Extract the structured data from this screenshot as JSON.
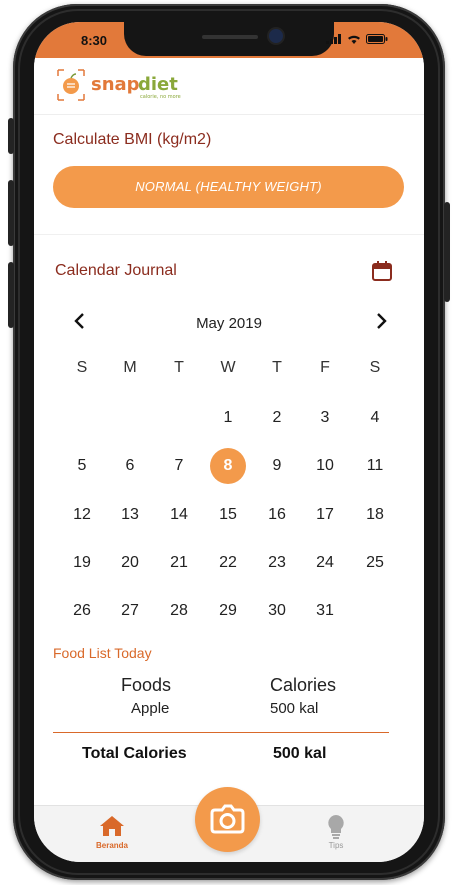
{
  "status_bar": {
    "time": "8:30"
  },
  "app": {
    "logo_text": "snapdiet",
    "tagline": "calorie, no more"
  },
  "bmi": {
    "title": "Calculate BMI (kg/m2)",
    "result": "NORMAL (HEALTHY WEIGHT)"
  },
  "calendar": {
    "title": "Calendar Journal",
    "month_label": "May 2019",
    "weekdays": [
      "S",
      "M",
      "T",
      "W",
      "T",
      "F",
      "S"
    ],
    "weeks": [
      [
        "",
        "",
        "",
        "1",
        "2",
        "3",
        "4"
      ],
      [
        "5",
        "6",
        "7",
        "8",
        "9",
        "10",
        "11"
      ],
      [
        "12",
        "13",
        "14",
        "15",
        "16",
        "17",
        "18"
      ],
      [
        "19",
        "20",
        "21",
        "22",
        "23",
        "24",
        "25"
      ],
      [
        "26",
        "27",
        "28",
        "29",
        "30",
        "31",
        ""
      ]
    ],
    "selected_day": "8"
  },
  "food_list": {
    "title": "Food List Today",
    "headers": {
      "foods": "Foods",
      "calories": "Calories"
    },
    "rows": [
      {
        "food": "Apple",
        "calories": "500 kal"
      }
    ],
    "total_label": "Total Calories",
    "total_value": "500 kal"
  },
  "bottom_nav": {
    "items": [
      {
        "label": "Beranda",
        "icon": "home-icon"
      },
      {
        "label": "Tips",
        "icon": "lightbulb-icon"
      }
    ],
    "fab_icon": "camera-icon"
  },
  "colors": {
    "accent": "#E2793A",
    "button": "#F39A4B",
    "title": "#8B2C1E"
  }
}
